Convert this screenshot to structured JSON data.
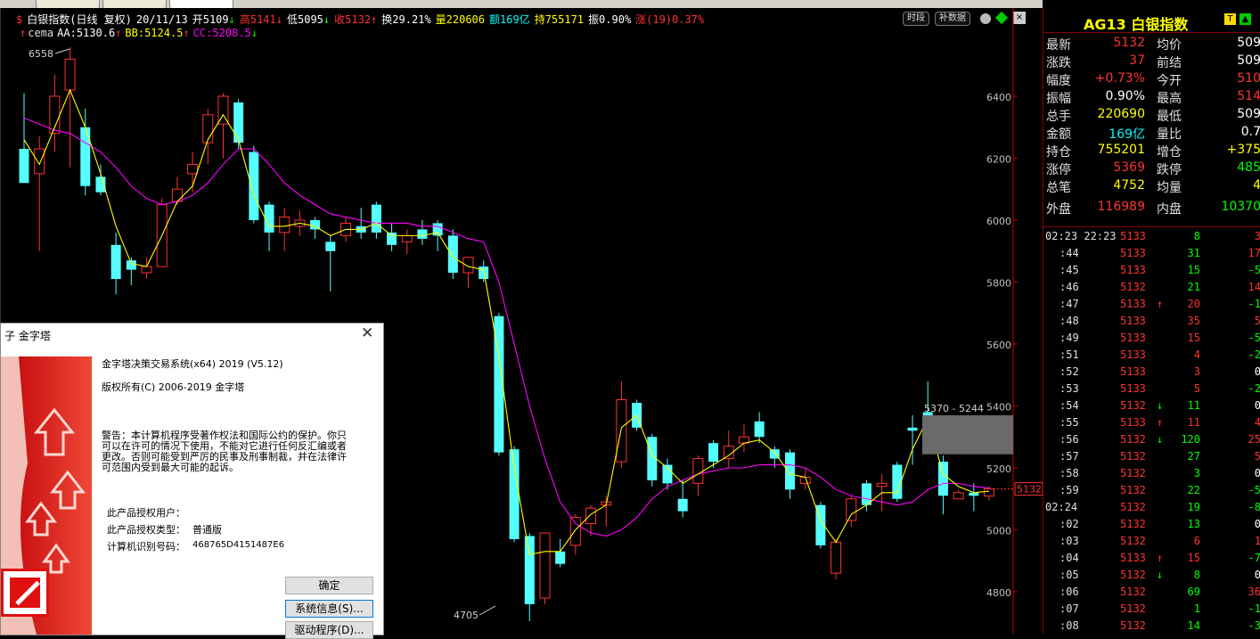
{
  "colors": {
    "up": "#ff3232",
    "down": "#54ffff",
    "yellow": "#ffff00",
    "cyan": "#00ffff",
    "magenta": "#ff00ff",
    "green": "#00ff00",
    "white": "#ffffff"
  },
  "chart_header": {
    "name": "白银指数(日线 复权)",
    "date": "20/11/13",
    "open": "开5109",
    "open_arrow": "↓",
    "high": "高5141",
    "high_arrow": "↓",
    "low": "低5095",
    "low_arrow": "↓",
    "close": "收5132",
    "close_arrow": "↑",
    "turnover": "换29.21%",
    "volume": "量220606",
    "amount": "额169亿",
    "position": "持755171",
    "amplitude": "振0.90%",
    "change": "涨(19)0.37%",
    "btn_time": "时段",
    "btn_fill": "补数据"
  },
  "indicator_line": {
    "name": "cema",
    "aa": "AA:5130.6",
    "aa_arrow": "↑",
    "bb": "BB:5124.5",
    "bb_arrow": "↑",
    "cc": "CC:5208.5",
    "cc_arrow": "↓"
  },
  "chart_data": {
    "type": "candlestick",
    "y_ticks": [
      "6400",
      "6200",
      "6000",
      "5800",
      "5600",
      "5400",
      "5200",
      "5000",
      "4800"
    ],
    "ylim": [
      4700,
      6600
    ],
    "high_label": "6558",
    "low_label": "4705",
    "range_label": "5370 - 5244",
    "last_price_label": "5132",
    "candles": [
      {
        "o": 6230,
        "h": 6410,
        "l": 6120,
        "c": 6120
      },
      {
        "o": 6150,
        "h": 6270,
        "l": 5900,
        "c": 6230
      },
      {
        "o": 6280,
        "h": 6470,
        "l": 6220,
        "c": 6400
      },
      {
        "o": 6420,
        "h": 6558,
        "l": 6170,
        "c": 6520
      },
      {
        "o": 6300,
        "h": 6360,
        "l": 6080,
        "c": 6110
      },
      {
        "o": 6140,
        "h": 6180,
        "l": 6080,
        "c": 6090
      },
      {
        "o": 5920,
        "h": 5960,
        "l": 5760,
        "c": 5810
      },
      {
        "o": 5870,
        "h": 5880,
        "l": 5790,
        "c": 5840
      },
      {
        "o": 5830,
        "h": 5880,
        "l": 5810,
        "c": 5850
      },
      {
        "o": 5850,
        "h": 6070,
        "l": 5850,
        "c": 6050
      },
      {
        "o": 6060,
        "h": 6140,
        "l": 6050,
        "c": 6100
      },
      {
        "o": 6150,
        "h": 6220,
        "l": 6090,
        "c": 6180
      },
      {
        "o": 6250,
        "h": 6360,
        "l": 6180,
        "c": 6340
      },
      {
        "o": 6310,
        "h": 6410,
        "l": 6200,
        "c": 6400
      },
      {
        "o": 6380,
        "h": 6390,
        "l": 6230,
        "c": 6250
      },
      {
        "o": 6220,
        "h": 6240,
        "l": 5990,
        "c": 6000
      },
      {
        "o": 6050,
        "h": 6060,
        "l": 5900,
        "c": 5960
      },
      {
        "o": 5960,
        "h": 6040,
        "l": 5900,
        "c": 6010
      },
      {
        "o": 5980,
        "h": 6030,
        "l": 5950,
        "c": 6000
      },
      {
        "o": 6000,
        "h": 6010,
        "l": 5940,
        "c": 5970
      },
      {
        "o": 5930,
        "h": 5950,
        "l": 5770,
        "c": 5900
      },
      {
        "o": 5950,
        "h": 6010,
        "l": 5930,
        "c": 5990
      },
      {
        "o": 5980,
        "h": 6040,
        "l": 5940,
        "c": 5960
      },
      {
        "o": 6050,
        "h": 6060,
        "l": 5940,
        "c": 5960
      },
      {
        "o": 5960,
        "h": 5990,
        "l": 5900,
        "c": 5920
      },
      {
        "o": 5930,
        "h": 5970,
        "l": 5890,
        "c": 5950
      },
      {
        "o": 5970,
        "h": 6000,
        "l": 5920,
        "c": 5940
      },
      {
        "o": 5990,
        "h": 6000,
        "l": 5900,
        "c": 5950
      },
      {
        "o": 5950,
        "h": 5970,
        "l": 5810,
        "c": 5830
      },
      {
        "o": 5830,
        "h": 5880,
        "l": 5780,
        "c": 5880
      },
      {
        "o": 5850,
        "h": 5870,
        "l": 5800,
        "c": 5810
      },
      {
        "o": 5690,
        "h": 5700,
        "l": 5240,
        "c": 5250
      },
      {
        "o": 5260,
        "h": 5270,
        "l": 4960,
        "c": 4970
      },
      {
        "o": 4980,
        "h": 4990,
        "l": 4705,
        "c": 4760
      },
      {
        "o": 4780,
        "h": 4990,
        "l": 4760,
        "c": 4990
      },
      {
        "o": 4930,
        "h": 4970,
        "l": 4880,
        "c": 4890
      },
      {
        "o": 4950,
        "h": 5050,
        "l": 4920,
        "c": 5040
      },
      {
        "o": 5020,
        "h": 5080,
        "l": 4980,
        "c": 5070
      },
      {
        "o": 5080,
        "h": 5110,
        "l": 5010,
        "c": 5090
      },
      {
        "o": 5220,
        "h": 5480,
        "l": 5200,
        "c": 5420
      },
      {
        "o": 5410,
        "h": 5420,
        "l": 5320,
        "c": 5330
      },
      {
        "o": 5300,
        "h": 5310,
        "l": 5140,
        "c": 5160
      },
      {
        "o": 5210,
        "h": 5230,
        "l": 5130,
        "c": 5150
      },
      {
        "o": 5100,
        "h": 5160,
        "l": 5040,
        "c": 5060
      },
      {
        "o": 5150,
        "h": 5240,
        "l": 5110,
        "c": 5230
      },
      {
        "o": 5280,
        "h": 5290,
        "l": 5200,
        "c": 5220
      },
      {
        "o": 5230,
        "h": 5320,
        "l": 5200,
        "c": 5270
      },
      {
        "o": 5280,
        "h": 5340,
        "l": 5250,
        "c": 5300
      },
      {
        "o": 5350,
        "h": 5380,
        "l": 5280,
        "c": 5300
      },
      {
        "o": 5260,
        "h": 5270,
        "l": 5200,
        "c": 5230
      },
      {
        "o": 5250,
        "h": 5260,
        "l": 5100,
        "c": 5130
      },
      {
        "o": 5150,
        "h": 5200,
        "l": 5130,
        "c": 5170
      },
      {
        "o": 5080,
        "h": 5090,
        "l": 4940,
        "c": 4950
      },
      {
        "o": 4860,
        "h": 4970,
        "l": 4840,
        "c": 4960
      },
      {
        "o": 5030,
        "h": 5110,
        "l": 5010,
        "c": 5100
      },
      {
        "o": 5150,
        "h": 5160,
        "l": 5060,
        "c": 5080
      },
      {
        "o": 5140,
        "h": 5180,
        "l": 5060,
        "c": 5150
      },
      {
        "o": 5210,
        "h": 5220,
        "l": 5090,
        "c": 5100
      },
      {
        "o": 5330,
        "h": 5370,
        "l": 5210,
        "c": 5320
      },
      {
        "o": 5380,
        "h": 5480,
        "l": 5300,
        "c": 5360
      },
      {
        "o": 5220,
        "h": 5240,
        "l": 5050,
        "c": 5110
      },
      {
        "o": 5100,
        "h": 5130,
        "l": 5100,
        "c": 5120
      },
      {
        "o": 5120,
        "h": 5150,
        "l": 5060,
        "c": 5110
      },
      {
        "o": 5109,
        "h": 5141,
        "l": 5095,
        "c": 5132
      }
    ],
    "ma_yellow": [
      6260,
      6180,
      6300,
      6420,
      6300,
      6150,
      5980,
      5860,
      5850,
      5950,
      6060,
      6110,
      6260,
      6340,
      6260,
      6080,
      5980,
      5980,
      5990,
      5980,
      5950,
      5970,
      5970,
      5990,
      5950,
      5950,
      5950,
      5960,
      5880,
      5850,
      5840,
      5560,
      5200,
      4920,
      4930,
      4930,
      5000,
      5050,
      5080,
      5330,
      5370,
      5240,
      5200,
      5150,
      5180,
      5210,
      5240,
      5280,
      5290,
      5250,
      5180,
      5170,
      5030,
      4960,
      5050,
      5080,
      5120,
      5120,
      5260,
      5360,
      5180,
      5140,
      5120,
      5125
    ],
    "ma_magenta": [
      6330,
      6310,
      6290,
      6280,
      6250,
      6220,
      6170,
      6110,
      6070,
      6050,
      6060,
      6080,
      6120,
      6180,
      6230,
      6230,
      6180,
      6120,
      6080,
      6050,
      6020,
      6010,
      6000,
      5990,
      5990,
      5990,
      5980,
      5980,
      5960,
      5940,
      5930,
      5800,
      5600,
      5400,
      5230,
      5090,
      5020,
      4990,
      4980,
      5000,
      5040,
      5100,
      5140,
      5160,
      5180,
      5190,
      5200,
      5200,
      5210,
      5210,
      5210,
      5200,
      5170,
      5130,
      5110,
      5100,
      5090,
      5080,
      5090,
      5130,
      5150,
      5150,
      5140,
      5135
    ]
  },
  "right_panel": {
    "symbol": "AG13",
    "name": "白银指数",
    "badge1": "T",
    "quote_rows": [
      {
        "l": "最新",
        "v": "5132",
        "vc": "up",
        "l2": "均价",
        "v2": "509",
        "v2c": "down_cut"
      },
      {
        "l": "涨跌",
        "v": "37",
        "vc": "up",
        "l2": "前结",
        "v2": "509",
        "v2c": "white"
      },
      {
        "l": "幅度",
        "v": "+0.73%",
        "vc": "up",
        "l2": "今开",
        "v2": "510",
        "v2c": "up"
      },
      {
        "l": "振幅",
        "v": "0.90%",
        "vc": "white",
        "l2": "最高",
        "v2": "514",
        "v2c": "up"
      },
      {
        "l": "总手",
        "v": "220690",
        "vc": "yellow",
        "l2": "最低",
        "v2": "509",
        "v2c": "white"
      },
      {
        "l": "金额",
        "v": "169亿",
        "vc": "cyan",
        "l2": "量比",
        "v2": "0.7",
        "v2c": "white"
      },
      {
        "l": "持仓",
        "v": "755201",
        "vc": "yellow",
        "l2": "增仓",
        "v2": "+375",
        "v2c": "yellow"
      },
      {
        "l": "涨停",
        "v": "5369",
        "vc": "up",
        "l2": "跌停",
        "v2": "485",
        "v2c": "green"
      },
      {
        "l": "总笔",
        "v": "4752",
        "vc": "yellow",
        "l2": "均量",
        "v2": "4",
        "v2c": "yellow"
      },
      {
        "l": "外盘",
        "v": "116989",
        "vc": "up",
        "l2": "内盘",
        "v2": "10370",
        "v2c": "green"
      }
    ],
    "ticks": [
      {
        "t": "02:23 22:23",
        "p": "5133",
        "pc": "up",
        "a": "",
        "ac": "up",
        "v": "8",
        "vc": "green",
        "d": "3",
        "dc": "up"
      },
      {
        "t": ":44",
        "p": "5133",
        "pc": "up",
        "a": "",
        "ac": "up",
        "v": "31",
        "vc": "green",
        "d": "17",
        "dc": "up"
      },
      {
        "t": ":45",
        "p": "5133",
        "pc": "up",
        "a": "",
        "ac": "up",
        "v": "15",
        "vc": "green",
        "d": "-5",
        "dc": "green"
      },
      {
        "t": ":46",
        "p": "5132",
        "pc": "up",
        "a": "",
        "ac": "up",
        "v": "21",
        "vc": "green",
        "d": "14",
        "dc": "up"
      },
      {
        "t": ":47",
        "p": "5133",
        "pc": "up",
        "a": "↑",
        "ac": "up",
        "v": "20",
        "vc": "up",
        "d": "-1",
        "dc": "green"
      },
      {
        "t": ":48",
        "p": "5133",
        "pc": "up",
        "a": "",
        "ac": "up",
        "v": "35",
        "vc": "up",
        "d": "5",
        "dc": "up"
      },
      {
        "t": ":49",
        "p": "5133",
        "pc": "up",
        "a": "",
        "ac": "up",
        "v": "15",
        "vc": "up",
        "d": "-5",
        "dc": "green"
      },
      {
        "t": ":51",
        "p": "5133",
        "pc": "up",
        "a": "",
        "ac": "up",
        "v": "4",
        "vc": "up",
        "d": "-2",
        "dc": "green"
      },
      {
        "t": ":52",
        "p": "5133",
        "pc": "up",
        "a": "",
        "ac": "up",
        "v": "3",
        "vc": "up",
        "d": "0",
        "dc": "white"
      },
      {
        "t": ":53",
        "p": "5133",
        "pc": "up",
        "a": "",
        "ac": "up",
        "v": "5",
        "vc": "up",
        "d": "-2",
        "dc": "green"
      },
      {
        "t": ":54",
        "p": "5132",
        "pc": "up",
        "a": "↓",
        "ac": "green",
        "v": "11",
        "vc": "green",
        "d": "0",
        "dc": "white"
      },
      {
        "t": ":55",
        "p": "5133",
        "pc": "up",
        "a": "↑",
        "ac": "up",
        "v": "11",
        "vc": "up",
        "d": "4",
        "dc": "up"
      },
      {
        "t": ":56",
        "p": "5132",
        "pc": "up",
        "a": "↓",
        "ac": "green",
        "v": "120",
        "vc": "green",
        "d": "25",
        "dc": "up"
      },
      {
        "t": ":57",
        "p": "5132",
        "pc": "up",
        "a": "",
        "ac": "up",
        "v": "27",
        "vc": "green",
        "d": "5",
        "dc": "up"
      },
      {
        "t": ":58",
        "p": "5132",
        "pc": "up",
        "a": "",
        "ac": "up",
        "v": "3",
        "vc": "green",
        "d": "0",
        "dc": "white"
      },
      {
        "t": ":59",
        "p": "5132",
        "pc": "up",
        "a": "",
        "ac": "up",
        "v": "22",
        "vc": "green",
        "d": "-5",
        "dc": "green"
      },
      {
        "t": "02:24",
        "p": "5132",
        "pc": "up",
        "a": "",
        "ac": "up",
        "v": "19",
        "vc": "green",
        "d": "-8",
        "dc": "green"
      },
      {
        "t": ":02",
        "p": "5132",
        "pc": "up",
        "a": "",
        "ac": "up",
        "v": "13",
        "vc": "green",
        "d": "0",
        "dc": "white"
      },
      {
        "t": ":03",
        "p": "5132",
        "pc": "up",
        "a": "",
        "ac": "up",
        "v": "6",
        "vc": "up",
        "d": "1",
        "dc": "up"
      },
      {
        "t": ":04",
        "p": "5133",
        "pc": "up",
        "a": "↑",
        "ac": "up",
        "v": "15",
        "vc": "up",
        "d": "-7",
        "dc": "green"
      },
      {
        "t": ":05",
        "p": "5132",
        "pc": "up",
        "a": "↓",
        "ac": "green",
        "v": "8",
        "vc": "green",
        "d": "0",
        "dc": "white"
      },
      {
        "t": ":06",
        "p": "5132",
        "pc": "up",
        "a": "",
        "ac": "up",
        "v": "69",
        "vc": "green",
        "d": "36",
        "dc": "up"
      },
      {
        "t": ":07",
        "p": "5132",
        "pc": "up",
        "a": "",
        "ac": "up",
        "v": "1",
        "vc": "green",
        "d": "-1",
        "dc": "green"
      },
      {
        "t": ":08",
        "p": "5132",
        "pc": "up",
        "a": "",
        "ac": "up",
        "v": "14",
        "vc": "green",
        "d": "-3",
        "dc": "green"
      }
    ]
  },
  "dialog": {
    "title": "子 金字塔",
    "product": "金字塔决策交易系统(x64) 2019 (V5.12)",
    "copyright": "版权所有(C) 2006-2019 金字塔",
    "warning_lines": [
      "警告：本计算机程序受著作权法和国际公约的保护。你只",
      "可以在许可的情况下使用，不能对它进行任何反汇编或者",
      "更改。否则可能受到严厉的民事及刑事制裁，并在法律许",
      "可范围内受到最大可能的起诉。"
    ],
    "user_label": "此产品授权用户：",
    "type_label": "此产品授权类型：",
    "type_value": "普通版",
    "machine_label": "计算机识别号码：",
    "machine_value": "468765D4151487E6",
    "ok": "确定",
    "sysinfo": "系统信息(S)...",
    "driver": "驱动程序(D)..."
  }
}
